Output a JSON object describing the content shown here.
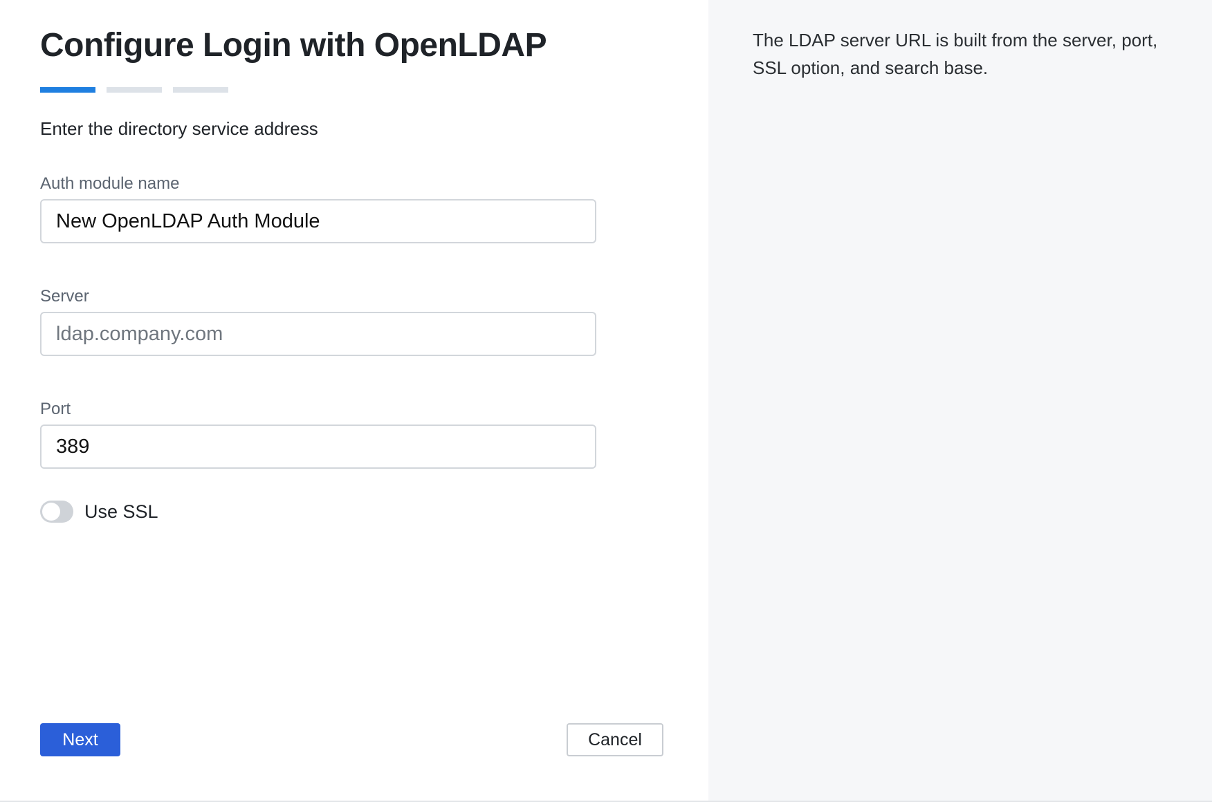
{
  "dialog": {
    "title": "Configure Login with OpenLDAP",
    "subtitle": "Enter the directory service address",
    "steps": {
      "total": 3,
      "current": 1
    }
  },
  "fields": {
    "auth_module_name": {
      "label": "Auth module name",
      "value": "New OpenLDAP Auth Module",
      "placeholder": ""
    },
    "server": {
      "label": "Server",
      "value": "",
      "placeholder": "ldap.company.com"
    },
    "port": {
      "label": "Port",
      "value": "389",
      "placeholder": ""
    }
  },
  "ssl": {
    "label": "Use SSL",
    "enabled": false
  },
  "buttons": {
    "next": "Next",
    "cancel": "Cancel"
  },
  "help": {
    "text": "The LDAP server URL is built from the server, port, SSL option, and search base."
  },
  "colors": {
    "accent": "#1f7fe0",
    "primary_button": "#2b5fd9",
    "panel_bg": "#f6f7f9"
  }
}
